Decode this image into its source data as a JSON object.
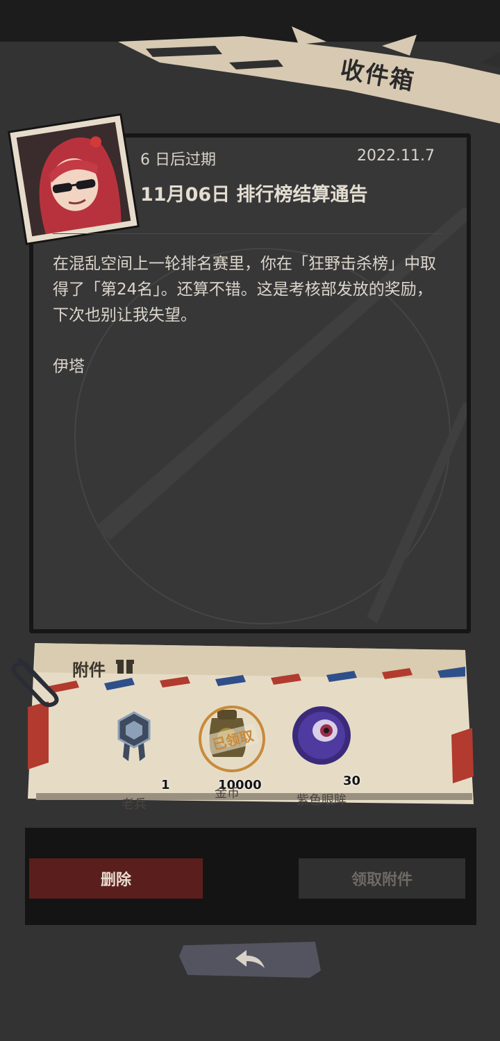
{
  "header": {
    "title": "收件箱"
  },
  "mail": {
    "expire": "6 日后过期",
    "date": "2022.11.7",
    "title": "11月06日 排行榜结算通告",
    "body": "在混乱空间上一轮排名赛里，你在「狂野击杀榜」中取得了「第24名」。还算不错。这是考核部发放的奖励，下次也别让我失望。",
    "signature": "伊塔"
  },
  "attachments": {
    "label": "附件",
    "stamp": "已领取",
    "items": [
      {
        "name": "老兵",
        "qty": "1",
        "icon": "veteran-badge-icon"
      },
      {
        "name": "金币",
        "qty": "10000",
        "icon": "gold-coin-bag-icon"
      },
      {
        "name": "紫色眼眸",
        "qty": "30",
        "icon": "purple-eye-orb-icon"
      }
    ]
  },
  "buttons": {
    "delete": "删除",
    "claim": "领取附件",
    "back": "back-arrow-icon"
  },
  "colors": {
    "accent_red": "#5a1f1c",
    "stamp": "#c88a3a",
    "paper": "#e8dfcc"
  }
}
